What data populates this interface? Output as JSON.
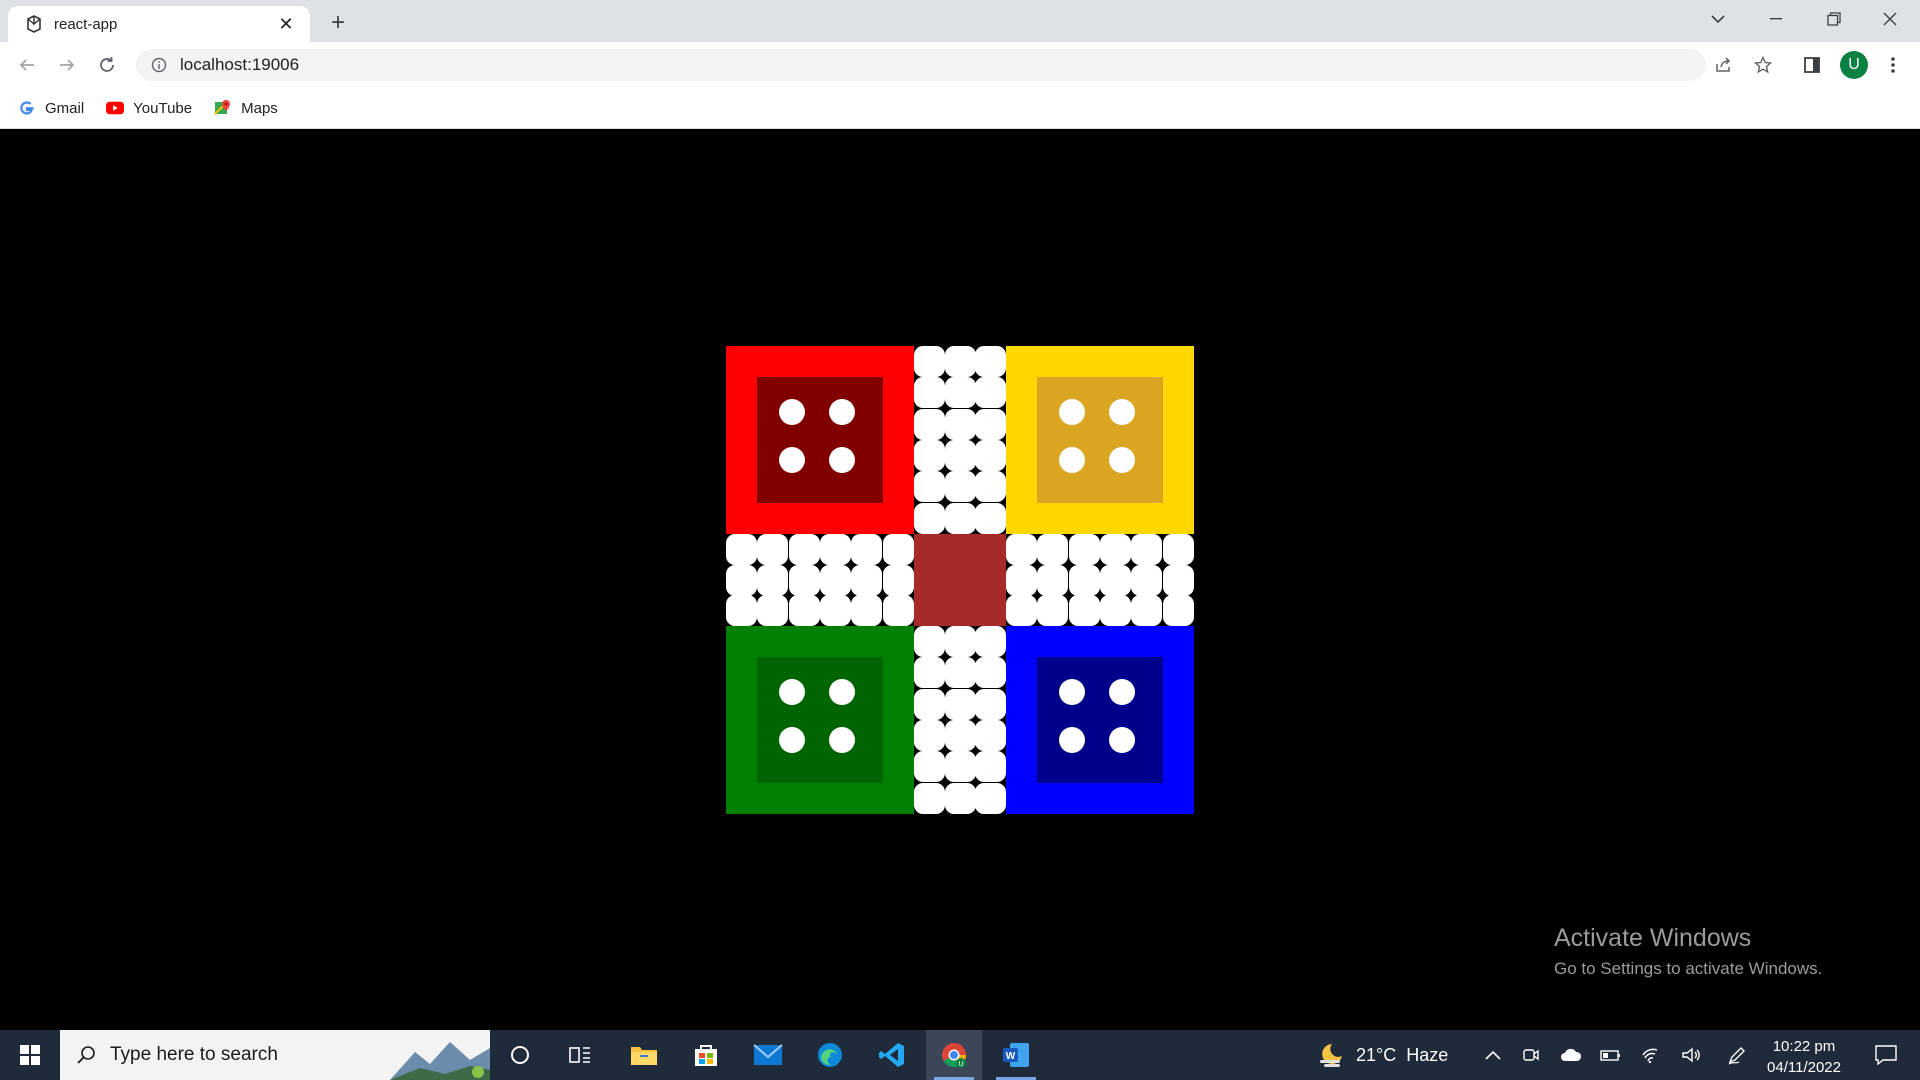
{
  "browser": {
    "tab_title": "react-app",
    "url": "localhost:19006",
    "profile_initial": "U",
    "bookmarks": [
      {
        "label": "Gmail"
      },
      {
        "label": "YouTube"
      },
      {
        "label": "Maps"
      }
    ]
  },
  "board": {
    "homes": [
      {
        "name": "red",
        "outer": "#ff0000",
        "inner": "#800000"
      },
      {
        "name": "yellow",
        "outer": "#ffd700",
        "inner": "#daa520"
      },
      {
        "name": "green",
        "outer": "#008000",
        "inner": "#006400"
      },
      {
        "name": "blue",
        "outer": "#0000ff",
        "inner": "#00008b"
      }
    ],
    "center_color": "#a52a2a",
    "track_color": "#ffffff",
    "star_symbol": "✦"
  },
  "watermark": {
    "line1": "Activate Windows",
    "line2": "Go to Settings to activate Windows."
  },
  "taskbar": {
    "search_placeholder": "Type here to search",
    "weather": "21°C  Haze",
    "time": "10:22 pm",
    "date": "04/11/2022"
  }
}
